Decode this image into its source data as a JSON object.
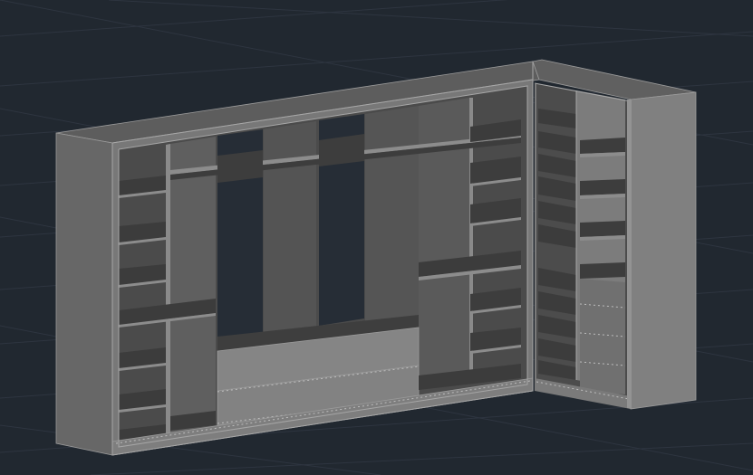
{
  "viewport": {
    "background": "#212830",
    "grid_color": "#2e3540",
    "grid_visible": true,
    "visual_style": "shaded-gray"
  },
  "model": {
    "object": "corner-wardrobe",
    "colors": {
      "body": "#7a7a7a",
      "side_panel": "#656565",
      "top_surface": "#5e5e5e",
      "interior_back": "#4a4a4a",
      "shelf_top": "#3c3c3c",
      "shelf_edge": "#8a8a8a",
      "drawer_front": "#7d7d7d",
      "edge_line": "#a6a6a6"
    }
  }
}
